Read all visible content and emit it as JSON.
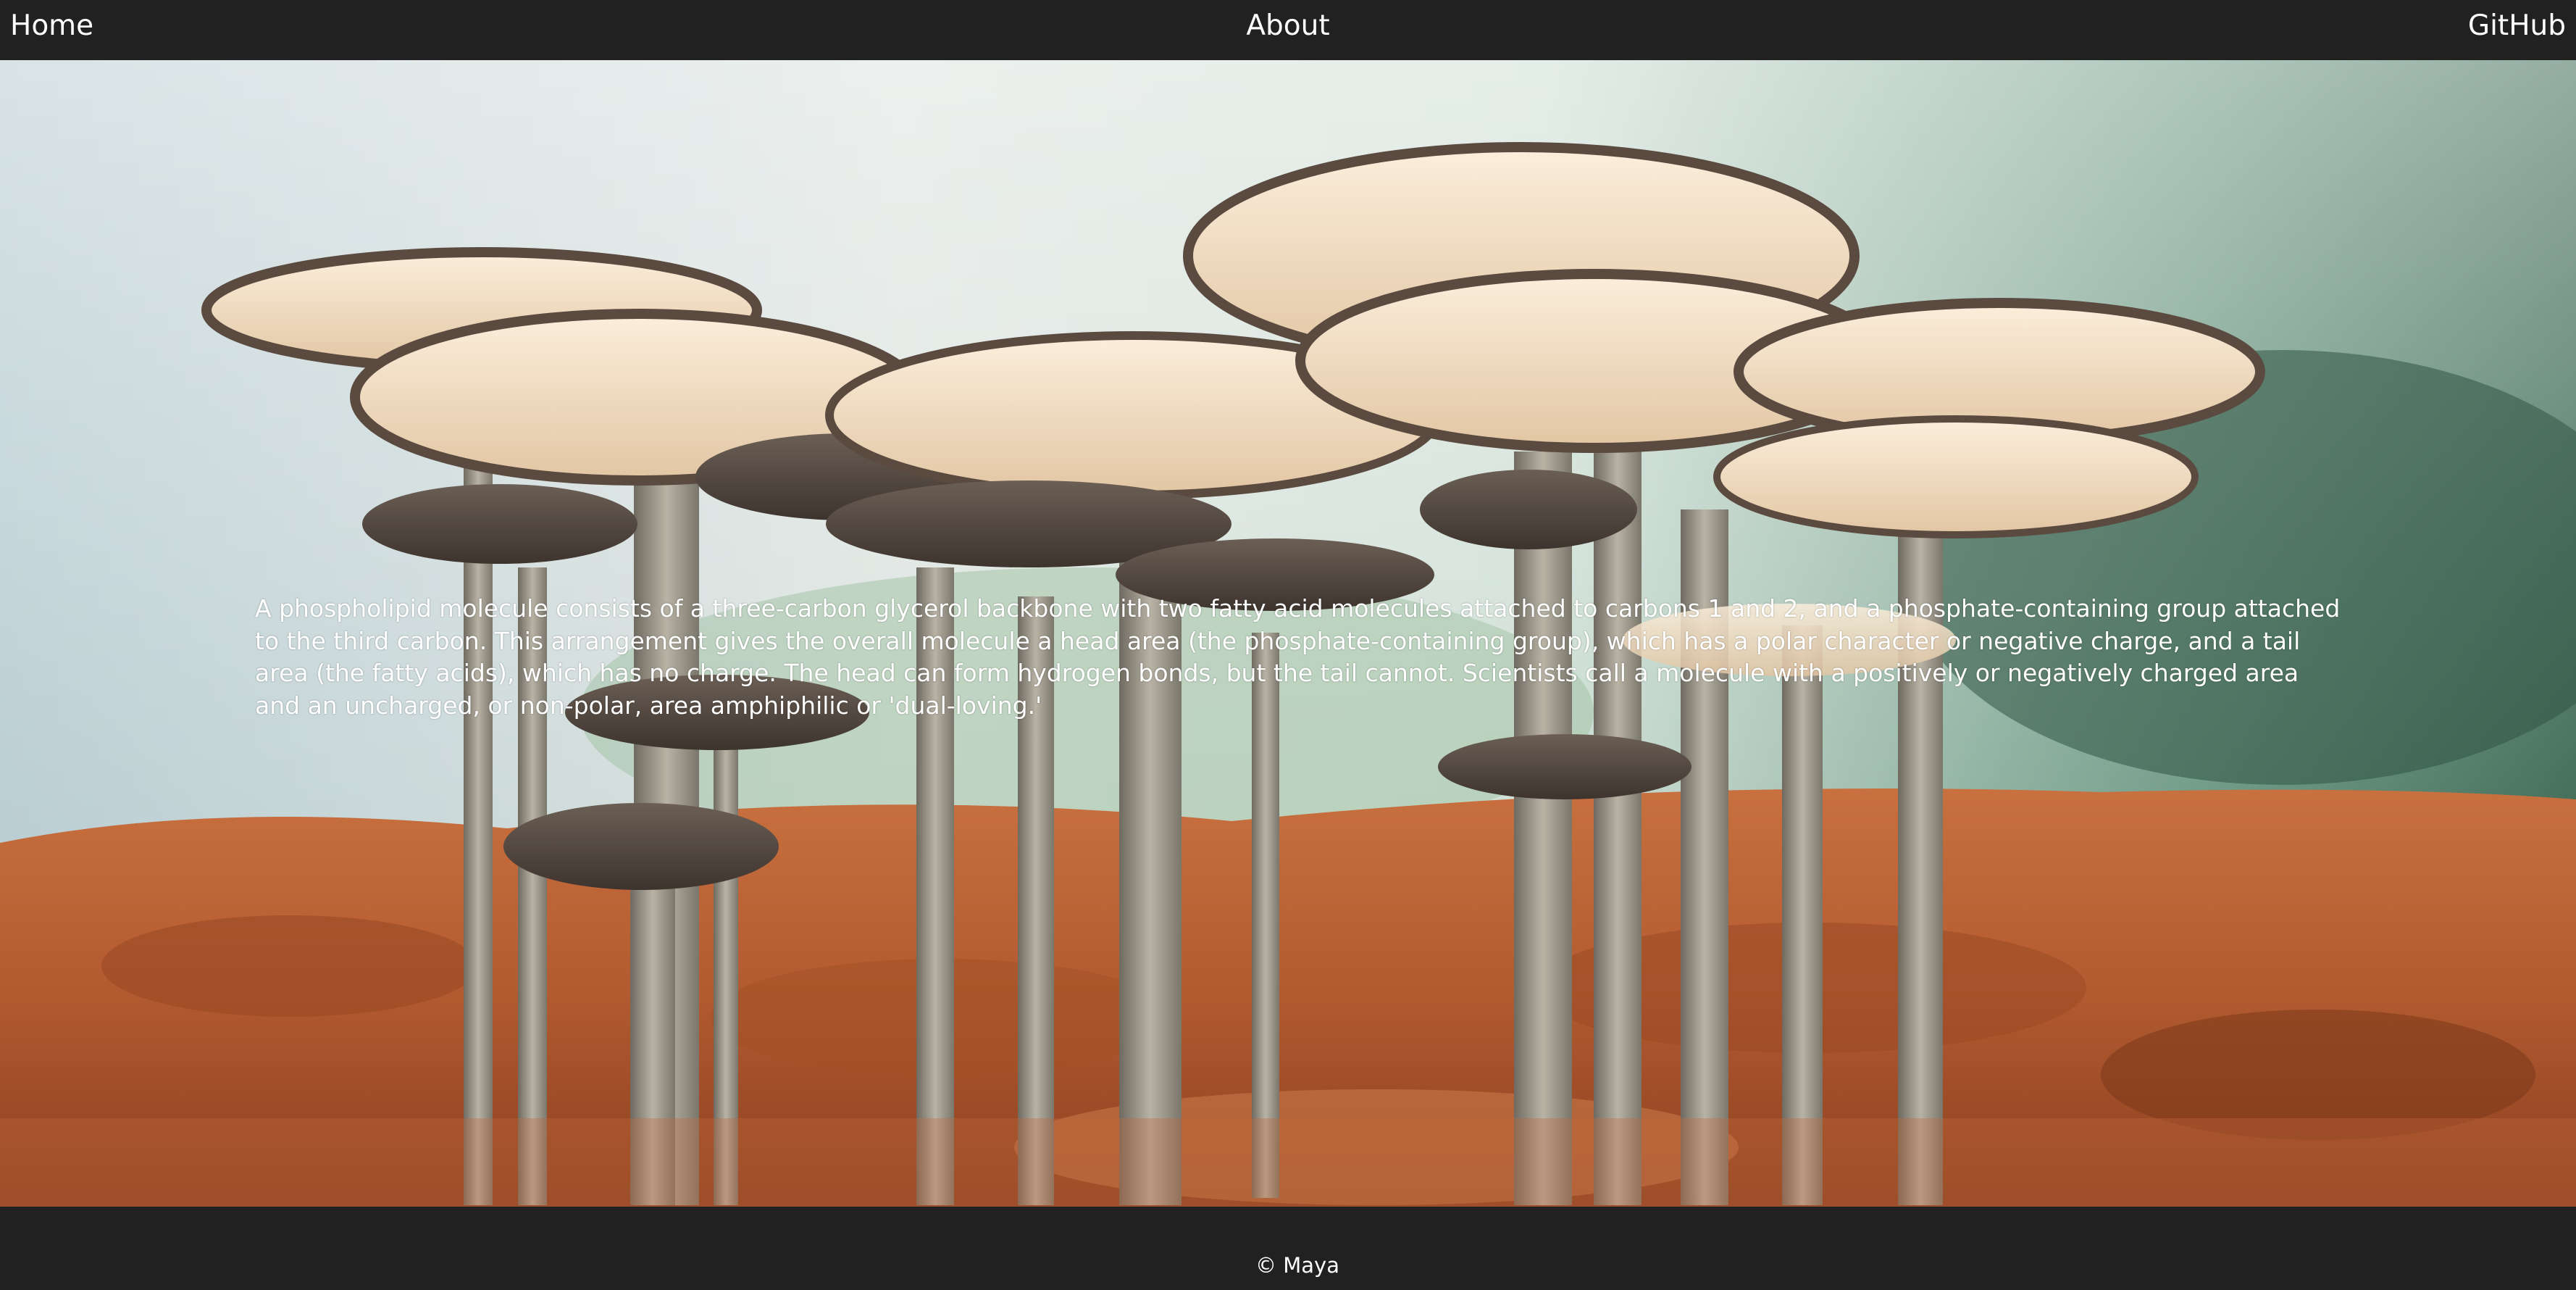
{
  "nav": {
    "home_label": "Home",
    "about_label": "About",
    "github_label": "GitHub"
  },
  "hero": {
    "image_subject": "mushrooms-photo",
    "paragraph": "A phospholipid molecule consists of a three-carbon glycerol backbone with two fatty acid molecules attached to carbons 1 and 2, and a phosphate-containing group attached to the third carbon. This arrangement gives the overall molecule a head area (the phosphate-containing group), which has a polar character or negative charge, and a tail area (the fatty acids), which has no charge. The head can form hydrogen bonds, but the tail cannot. Scientists call a molecule with a positively or negatively charged area and an uncharged, or non-polar, area amphiphilic or 'dual-loving.'"
  },
  "footer": {
    "copyright": "© Maya"
  },
  "colors": {
    "bar_background": "#212121",
    "text": "#ffffff",
    "soil": "#b85e35",
    "cap_underside": "#f1dcc0",
    "stem": "#a39e90"
  }
}
